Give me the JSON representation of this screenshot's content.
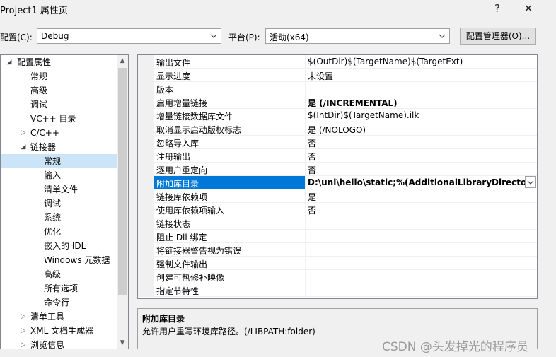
{
  "window": {
    "title": "Project1 属性页",
    "help": "?",
    "close": "✕"
  },
  "config_bar": {
    "config_label": "配置(C):",
    "config_value": "Debug",
    "platform_label": "平台(P):",
    "platform_value": "活动(x64)",
    "manager_button": "配置管理器(O)..."
  },
  "tree": {
    "items": [
      {
        "label": "配置属性"
      },
      {
        "label": "常规"
      },
      {
        "label": "高级"
      },
      {
        "label": "调试"
      },
      {
        "label": "VC++ 目录"
      },
      {
        "label": "C/C++"
      },
      {
        "label": "链接器"
      },
      {
        "label": "常规"
      },
      {
        "label": "输入"
      },
      {
        "label": "清单文件"
      },
      {
        "label": "调试"
      },
      {
        "label": "系统"
      },
      {
        "label": "优化"
      },
      {
        "label": "嵌入的 IDL"
      },
      {
        "label": "Windows 元数据"
      },
      {
        "label": "高级"
      },
      {
        "label": "所有选项"
      },
      {
        "label": "命令行"
      },
      {
        "label": "清单工具"
      },
      {
        "label": "XML 文档生成器"
      },
      {
        "label": "浏览信息"
      }
    ]
  },
  "grid": {
    "rows": [
      {
        "name": "输出文件",
        "value": "$(OutDir)$(TargetName)$(TargetExt)"
      },
      {
        "name": "显示进度",
        "value": "未设置"
      },
      {
        "name": "版本",
        "value": ""
      },
      {
        "name": "启用增量链接",
        "value": "是 (/INCREMENTAL)"
      },
      {
        "name": "增量链接数据库文件",
        "value": "$(IntDir)$(TargetName).ilk"
      },
      {
        "name": "取消显示启动版权标志",
        "value": "是 (/NOLOGO)"
      },
      {
        "name": "忽略导入库",
        "value": "否"
      },
      {
        "name": "注册输出",
        "value": "否"
      },
      {
        "name": "逐用户重定向",
        "value": "否"
      },
      {
        "name": "附加库目录",
        "value": "D:\\uni\\hello\\static;%(AdditionalLibraryDirectories)"
      },
      {
        "name": "链接库依赖项",
        "value": "是"
      },
      {
        "name": "使用库依赖项输入",
        "value": "否"
      },
      {
        "name": "链接状态",
        "value": ""
      },
      {
        "name": "阻止 Dll 绑定",
        "value": ""
      },
      {
        "name": "将链接器警告视为错误",
        "value": ""
      },
      {
        "name": "强制文件输出",
        "value": ""
      },
      {
        "name": "创建可热修补映像",
        "value": ""
      },
      {
        "name": "指定节特性",
        "value": ""
      }
    ]
  },
  "description": {
    "title": "附加库目录",
    "text": "允许用户重写环境库路径。(/LIBPATH:folder)"
  },
  "watermark": "CSDN @头发掉光的程序员",
  "colors": {
    "selection": "#0078d7",
    "tree_selection": "#cce4f7"
  }
}
